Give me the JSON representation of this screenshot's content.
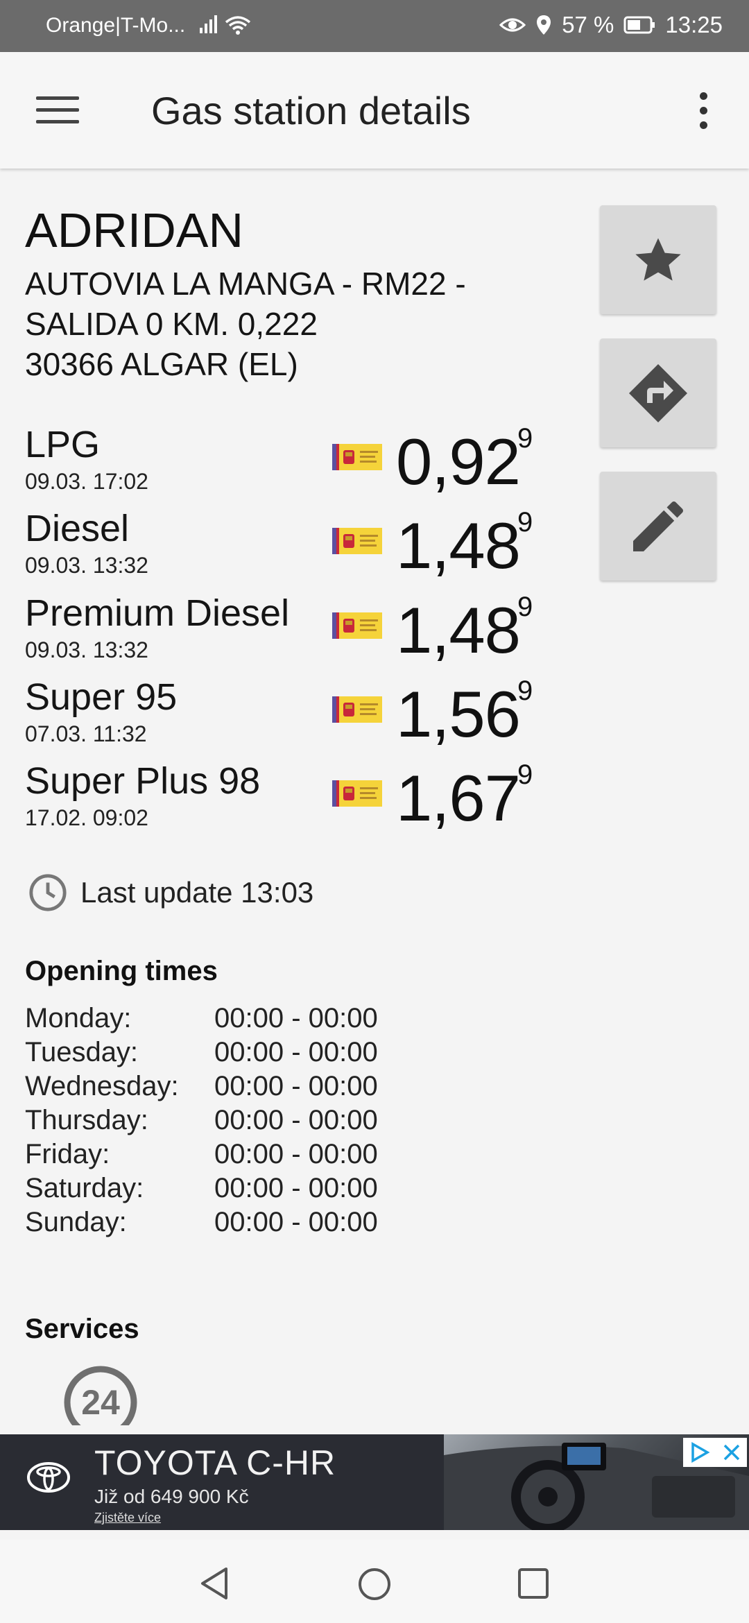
{
  "status_bar": {
    "carrier": "Orange|T-Mo...",
    "battery": "57 %",
    "time": "13:25"
  },
  "app_bar": {
    "title": "Gas station details"
  },
  "station": {
    "name": "ADRIDAN",
    "address_line1": "AUTOVIA LA MANGA - RM22 -",
    "address_line2": "SALIDA 0 KM. 0,222",
    "address_line3": "30366 ALGAR (EL)"
  },
  "side_buttons": {
    "favorite_icon": "star-icon",
    "directions_icon": "directions-icon",
    "edit_icon": "pencil-icon"
  },
  "fuels": [
    {
      "name": "LPG",
      "date": "09.03. 17:02",
      "price": "0,92",
      "sup": "9"
    },
    {
      "name": "Diesel",
      "date": "09.03. 13:32",
      "price": "1,48",
      "sup": "9"
    },
    {
      "name": "Premium Diesel",
      "date": "09.03. 13:32",
      "price": "1,48",
      "sup": "9"
    },
    {
      "name": "Super 95",
      "date": "07.03. 11:32",
      "price": "1,56",
      "sup": "9"
    },
    {
      "name": "Super Plus 98",
      "date": "17.02. 09:02",
      "price": "1,67",
      "sup": "9"
    }
  ],
  "last_update": "Last update 13:03",
  "opening": {
    "heading": "Opening times",
    "days": [
      {
        "day": "Monday:",
        "hours": "00:00 - 00:00"
      },
      {
        "day": "Tuesday:",
        "hours": "00:00 - 00:00"
      },
      {
        "day": "Wednesday:",
        "hours": "00:00 - 00:00"
      },
      {
        "day": "Thursday:",
        "hours": "00:00 - 00:00"
      },
      {
        "day": "Friday:",
        "hours": "00:00 - 00:00"
      },
      {
        "day": "Saturday:",
        "hours": "00:00 - 00:00"
      },
      {
        "day": "Sunday:",
        "hours": "00:00 - 00:00"
      }
    ]
  },
  "services": {
    "heading": "Services",
    "badge": "24"
  },
  "ad": {
    "title": "TOYOTA C-HR",
    "price": "Již od 649 900 Kč",
    "cta": "Zjistěte více"
  },
  "colors": {
    "flag_yellow": "#f5d33a",
    "flag_red": "#c8283a",
    "button_grey": "#d9d9d9",
    "ad_bg": "#2a2c33",
    "adchoice_blue": "#1ba1e2"
  }
}
